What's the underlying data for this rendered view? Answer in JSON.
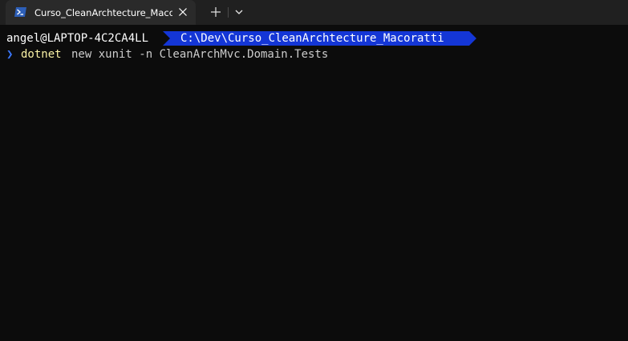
{
  "tabbar": {
    "tab_title": "Curso_CleanArchtecture_Macoratti",
    "tab_icon": "powershell-icon",
    "close_icon": "close-icon",
    "new_tab_icon": "plus-icon",
    "dropdown_icon": "chevron-down-icon"
  },
  "terminal": {
    "user_host": "angel@LAPTOP-4C2CA4LL",
    "path": "C:\\Dev\\Curso_CleanArchtecture_Macoratti",
    "prompt_symbol": "❯",
    "command": "dotnet",
    "arguments": "new xunit -n CleanArchMvc.Domain.Tests"
  },
  "colors": {
    "background": "#0c0c0c",
    "tabbar": "#202020",
    "active_tab": "#2a2a2a",
    "path_segment": "#1436d6",
    "prompt_chevron": "#3b78ff",
    "command": "#f9f1a5",
    "arguments": "#cccccc"
  }
}
